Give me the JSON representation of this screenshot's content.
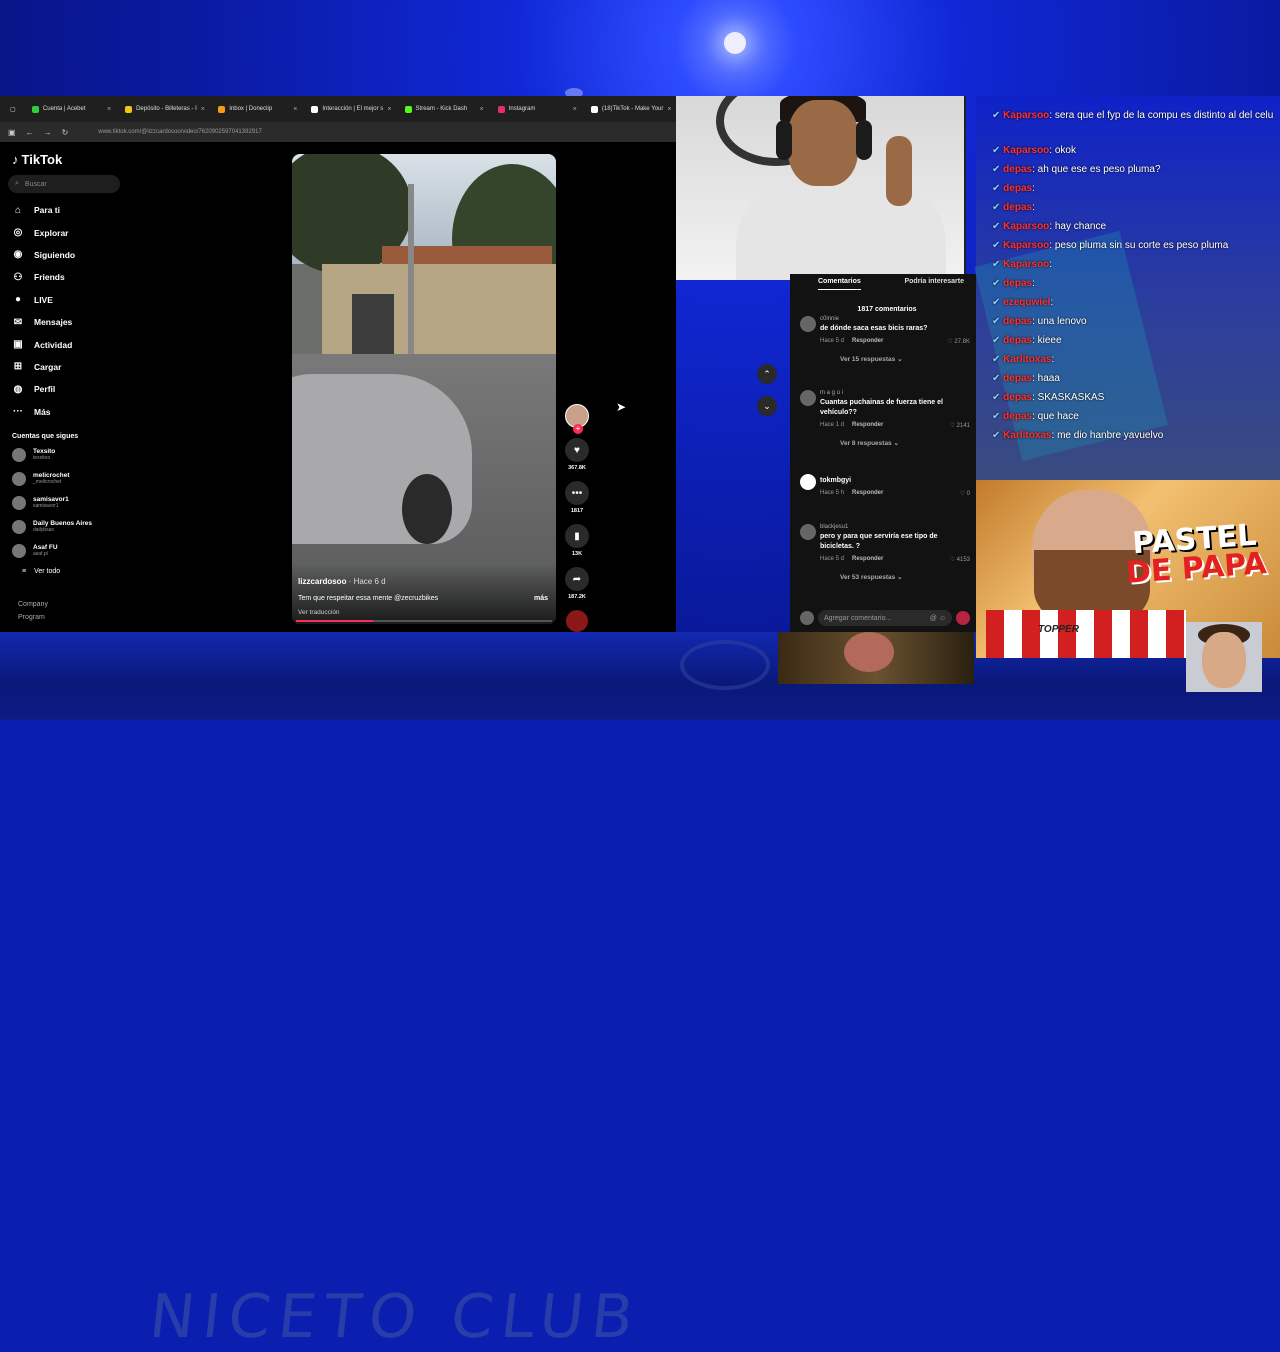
{
  "browser": {
    "tabs": [
      {
        "label": "Cuenta | Acebet",
        "color": "#2ecc40"
      },
      {
        "label": "Depósito - Billeteras - I",
        "color": "#f0c419"
      },
      {
        "label": "Inbox | Doneclip",
        "color": "#f39c12"
      },
      {
        "label": "Interacción | El mejor s",
        "color": "#ffffff"
      },
      {
        "label": "Stream - Kick Dash",
        "color": "#53fc18"
      },
      {
        "label": "Instagram",
        "color": "#e1306c"
      },
      {
        "label": "(18)TikTok - Make Your",
        "color": "#ffffff"
      }
    ],
    "url": "www.tiktok.com/@lizzcardosoo/video/7620902597041392917"
  },
  "tiktok": {
    "logo": "TikTok",
    "search_placeholder": "Buscar",
    "menu": [
      {
        "label": "Para ti",
        "icon": "home-icon",
        "glyph": "⌂"
      },
      {
        "label": "Explorar",
        "icon": "compass-icon",
        "glyph": "◎"
      },
      {
        "label": "Siguiendo",
        "icon": "following-icon",
        "glyph": "◉"
      },
      {
        "label": "Friends",
        "icon": "friends-icon",
        "glyph": "⚇"
      },
      {
        "label": "LIVE",
        "icon": "live-icon",
        "glyph": "●"
      },
      {
        "label": "Mensajes",
        "icon": "messages-icon",
        "glyph": "✉"
      },
      {
        "label": "Actividad",
        "icon": "activity-icon",
        "glyph": "▣"
      },
      {
        "label": "Cargar",
        "icon": "upload-icon",
        "glyph": "⊞"
      },
      {
        "label": "Perfil",
        "icon": "profile-icon",
        "glyph": "◍"
      },
      {
        "label": "Más",
        "icon": "more-icon",
        "glyph": "···"
      }
    ],
    "following_header": "Cuentas que sigues",
    "following": [
      {
        "name": "Texsito",
        "handle": "texsitoo"
      },
      {
        "name": "melicrochet",
        "handle": "_melicrochet"
      },
      {
        "name": "samisavor1",
        "handle": "samisavor1"
      },
      {
        "name": "Daily Buenos Aires",
        "handle": "dailybsas"
      },
      {
        "name": "Asaf FU",
        "handle": "asaf.pl"
      }
    ],
    "see_all": "Ver todo",
    "company": "Company",
    "program": "Program",
    "video": {
      "username": "lizzcardosoo",
      "time": " · Hace 6 d",
      "caption": "Tem que respeitar essa mente @zecruzbikes",
      "more": "más",
      "translate": "Ver traducción",
      "progress": 0.3
    },
    "actions": {
      "likes": "367.8K",
      "comments": "1817",
      "saves": "13K",
      "shares": "187.2K"
    }
  },
  "comments": {
    "tab_active": "Comentarios",
    "tab_other": "Podría interesarte",
    "count": "1817 comentarios",
    "items": [
      {
        "user": "c0innie",
        "text": "de dónde saca esas bicis raras?",
        "time": "Hace 5 d",
        "reply": "Responder",
        "likes": "27.8K",
        "more": "Ver 15 respuestas"
      },
      {
        "user": "m a g u i",
        "text": "Cuantas puchainas de fuerza tiene el vehículo??",
        "time": "Hace 1 d",
        "reply": "Responder",
        "likes": "2141",
        "more": "Ver 8 respuestas"
      },
      {
        "user": "",
        "text": "tokmbgyi",
        "time": "Hace 5 h",
        "reply": "Responder",
        "likes": "0",
        "more": ""
      },
      {
        "user": "blackjesu1",
        "text": "pero y para que serviría ese tipo de bicicletas. ?",
        "time": "Hace 5 d",
        "reply": "Responder",
        "likes": "4153",
        "more": "Ver 53 respuestas"
      }
    ],
    "input_placeholder": "Agregar comentario..."
  },
  "chat": [
    {
      "user": "Kaparsoo",
      "msg": ": sera que el fyp de la compu es distinto al del celu"
    },
    {
      "user": "Kaparsoo",
      "msg": ": okok"
    },
    {
      "user": "depas",
      "msg": ": ah que ese es peso pluma?"
    },
    {
      "user": "depas",
      "msg": ":"
    },
    {
      "user": "depas",
      "msg": ":"
    },
    {
      "user": "Kaparsoo",
      "msg": ": hay chance"
    },
    {
      "user": "Kaparsoo",
      "msg": ": peso pluma sin su corte   es peso pluma"
    },
    {
      "user": "Kaparsoo",
      "msg": ":"
    },
    {
      "user": "depas",
      "msg": ":"
    },
    {
      "user": "ezequwiel",
      "msg": ":"
    },
    {
      "user": "depas",
      "msg": ": una lenovo"
    },
    {
      "user": "depas",
      "msg": ": kieee"
    },
    {
      "user": "Karlitoxas",
      "msg": ":"
    },
    {
      "user": "depas",
      "msg": ": haaa"
    },
    {
      "user": "depas",
      "msg": ": SKASKASKAS"
    },
    {
      "user": "depas",
      "msg": ": que hace"
    },
    {
      "user": "Karlitoxas",
      "msg": ": me dio hanbre yavuelvo"
    }
  ],
  "overlay": {
    "title_line1": "PASTEL",
    "title_line2": "DE PAPA",
    "shirt_text": "TOPPER",
    "club_text": "NICETO CLUB"
  }
}
